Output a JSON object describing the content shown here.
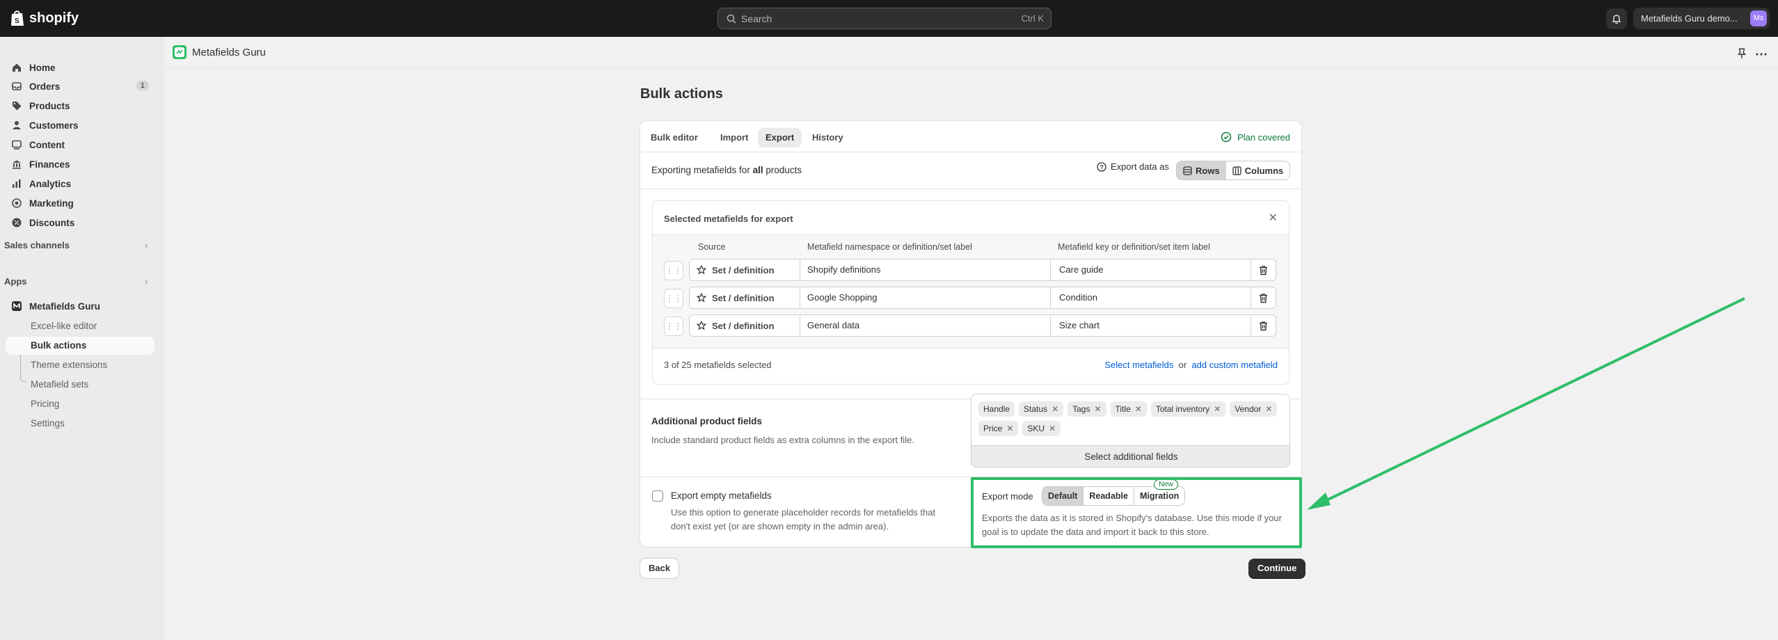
{
  "topbar": {
    "brand": "shopify",
    "search_placeholder": "Search",
    "search_shortcut": "Ctrl K",
    "account_name": "Metafields Guru demo...",
    "account_initials": "Ms"
  },
  "sidebar": {
    "items": [
      {
        "label": "Home",
        "icon": "home-icon"
      },
      {
        "label": "Orders",
        "icon": "inbox-icon",
        "badge": "1"
      },
      {
        "label": "Products",
        "icon": "tag-icon"
      },
      {
        "label": "Customers",
        "icon": "person-icon"
      },
      {
        "label": "Content",
        "icon": "content-icon"
      },
      {
        "label": "Finances",
        "icon": "bank-icon"
      },
      {
        "label": "Analytics",
        "icon": "chart-icon"
      },
      {
        "label": "Marketing",
        "icon": "target-icon"
      },
      {
        "label": "Discounts",
        "icon": "discount-icon"
      }
    ],
    "sales_channels": "Sales channels",
    "apps": "Apps",
    "app_name": "Metafields Guru",
    "app_subitems": [
      "Excel-like editor",
      "Bulk actions",
      "Theme extensions",
      "Metafield sets",
      "Pricing",
      "Settings"
    ]
  },
  "appbar": {
    "title": "Metafields Guru"
  },
  "page": {
    "title": "Bulk actions",
    "tabs": [
      "Bulk editor",
      "Import",
      "Export",
      "History"
    ],
    "plan_status": "Plan covered",
    "exporting_prefix": "Exporting metafields for ",
    "exporting_bold": "all",
    "exporting_suffix": " products",
    "export_as_label": "Export data as",
    "export_as_options": [
      "Rows",
      "Columns"
    ],
    "selected_title": "Selected metafields for export",
    "columns": [
      "Source",
      "Metafield namespace or definition/set label",
      "Metafield key or definition/set item label"
    ],
    "rows": [
      {
        "source": "Set / definition",
        "namespace": "Shopify definitions",
        "key": "Care guide"
      },
      {
        "source": "Set / definition",
        "namespace": "Google Shopping",
        "key": "Condition"
      },
      {
        "source": "Set / definition",
        "namespace": "General data",
        "key": "Size chart"
      }
    ],
    "count_text": "3 of 25 metafields selected",
    "select_metafields": "Select metafields",
    "or_text": "or",
    "add_custom": "add custom metafield",
    "additional_title": "Additional product fields",
    "additional_desc": "Include standard product fields as extra columns in the export file.",
    "chips": [
      "Handle",
      "Status",
      "Tags",
      "Title",
      "Total inventory",
      "Vendor",
      "Price",
      "SKU"
    ],
    "select_additional": "Select additional fields",
    "export_empty_label": "Export empty metafields",
    "export_empty_desc": "Use this option to generate placeholder records for metafields that don't exist yet (or are shown empty in the admin area).",
    "export_mode_label": "Export mode",
    "export_modes": [
      "Default",
      "Readable",
      "Migration"
    ],
    "new_badge": "New",
    "export_mode_desc": "Exports the data as it is stored in Shopify's database. Use this mode if your goal is to update the data and import it back to this store.",
    "back": "Back",
    "continue": "Continue"
  },
  "colors": {
    "accent_green": "#2fbe6a",
    "link_blue": "#005bd3",
    "plan_green": "#0d7a38"
  }
}
